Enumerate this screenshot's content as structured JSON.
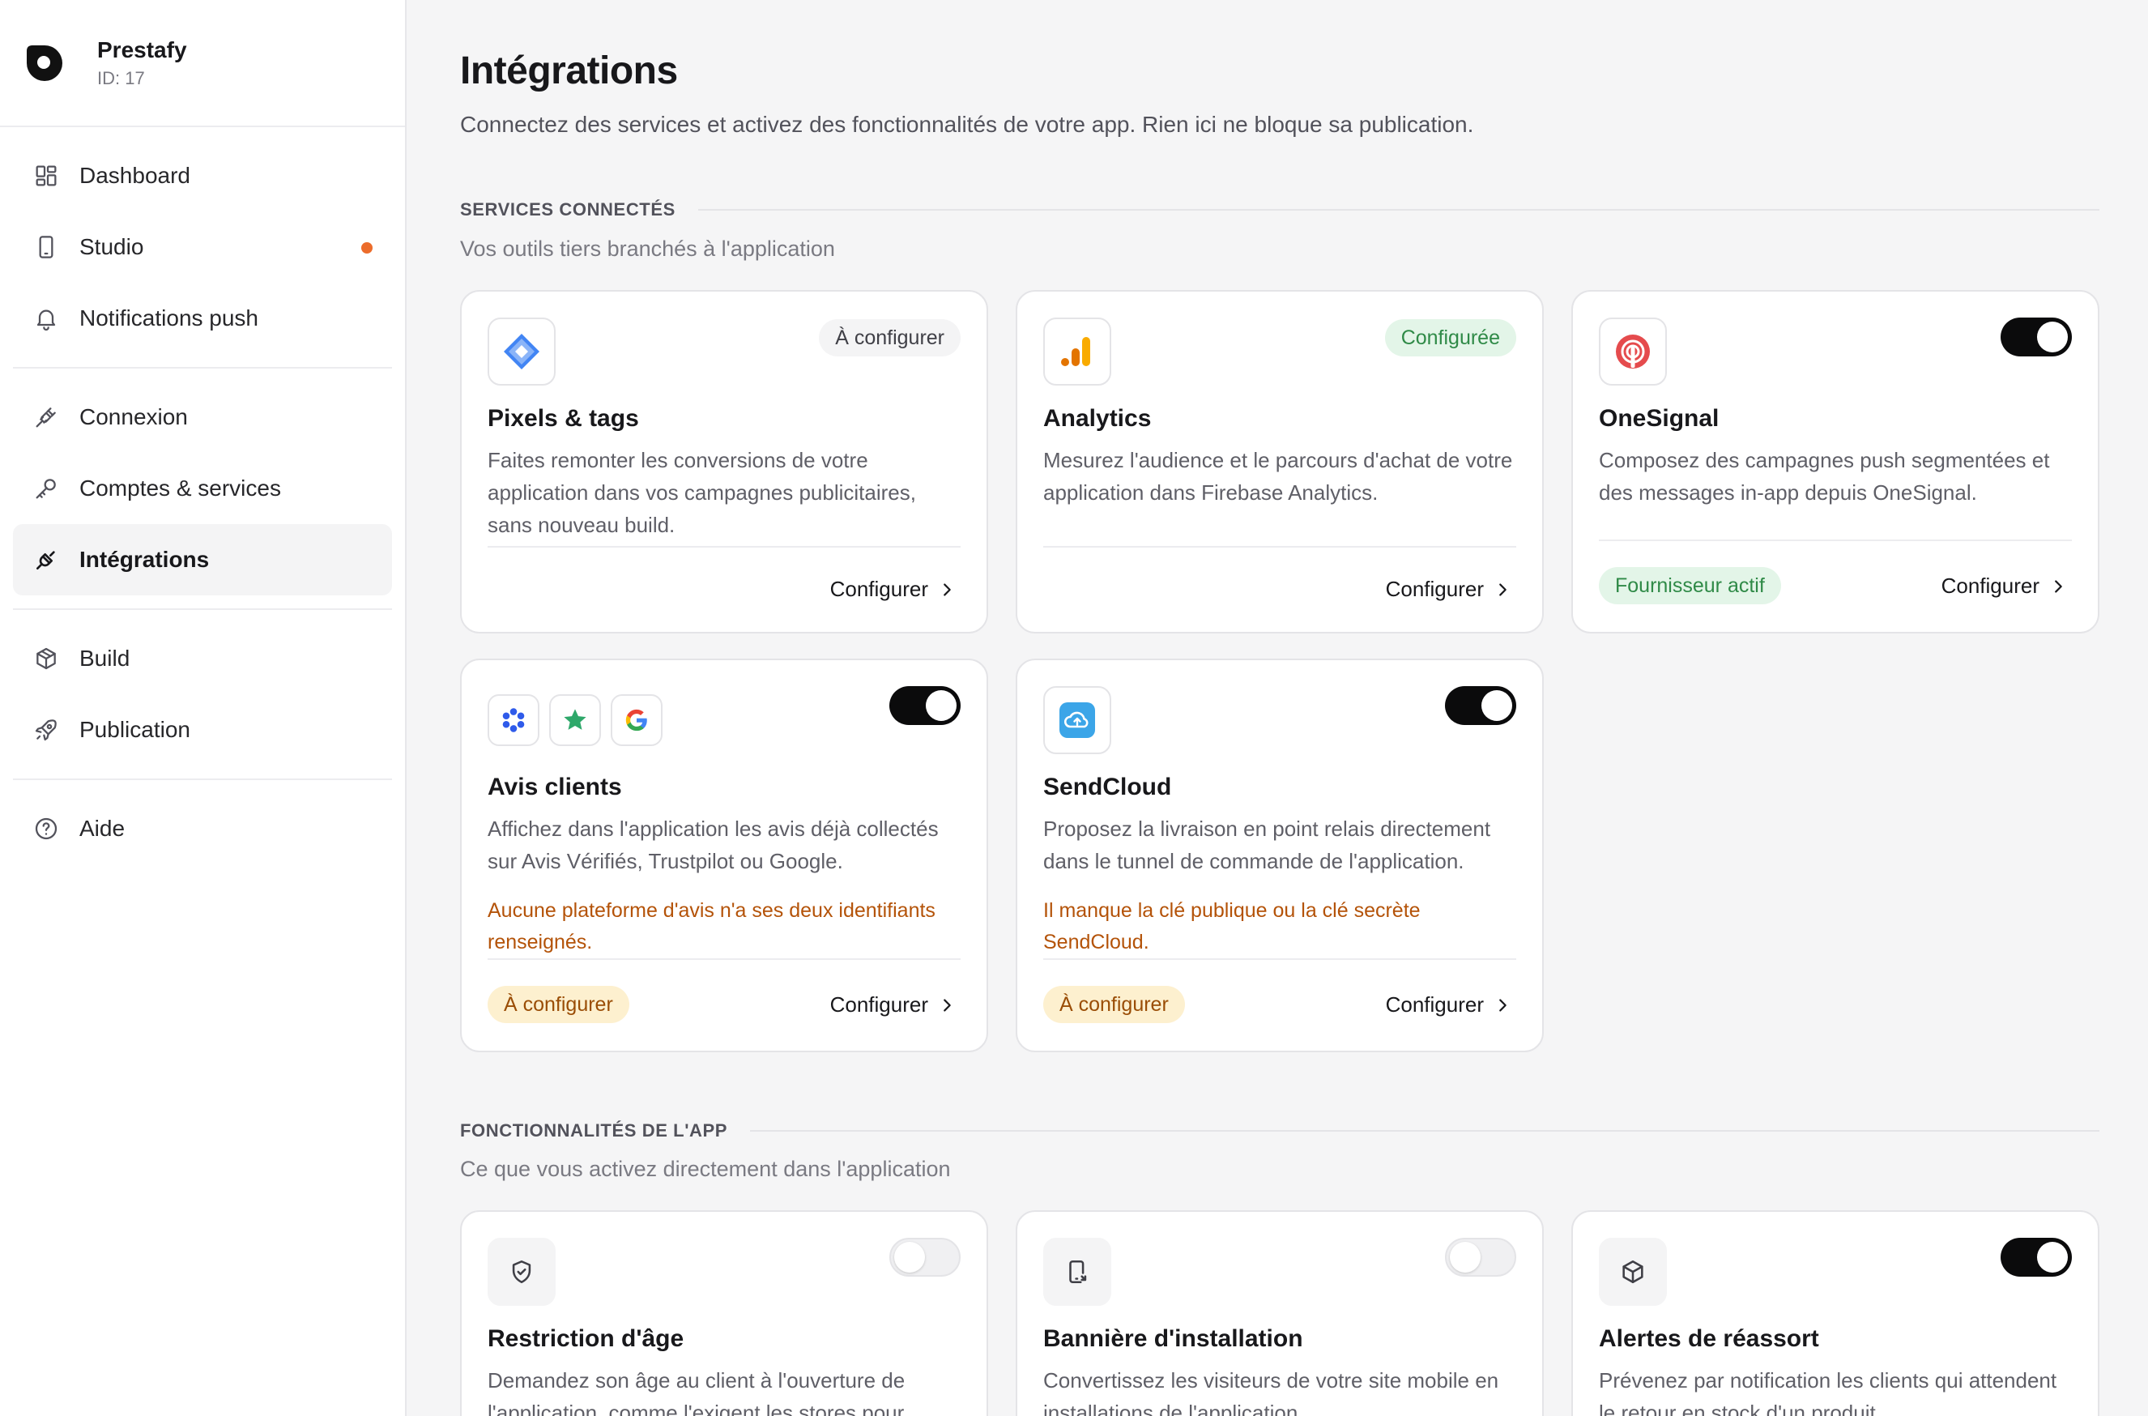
{
  "brand": {
    "name": "Prestafy",
    "id": "ID: 17"
  },
  "nav": {
    "dashboard": "Dashboard",
    "studio": "Studio",
    "push": "Notifications push",
    "connexion": "Connexion",
    "accounts": "Comptes & services",
    "integrations": "Intégrations",
    "build": "Build",
    "publication": "Publication",
    "help": "Aide"
  },
  "page": {
    "title": "Intégrations",
    "subtitle": "Connectez des services et activez des fonctionnalités de votre app. Rien ici ne bloque sa publication."
  },
  "services": {
    "title": "SERVICES CONNECTÉS",
    "subtitle": "Vos outils tiers branchés à l'application",
    "pixels": {
      "title": "Pixels & tags",
      "desc": "Faites remonter les conversions de votre application dans vos campagnes publicitaires, sans nouveau build.",
      "badge": "À configurer",
      "action": "Configurer"
    },
    "analytics": {
      "title": "Analytics",
      "desc": "Mesurez l'audience et le parcours d'achat de votre application dans Firebase Analytics.",
      "badge": "Configurée",
      "action": "Configurer"
    },
    "onesignal": {
      "title": "OneSignal",
      "desc": "Composez des campagnes push segmentées et des messages in-app depuis OneSignal.",
      "badge": "Fournisseur actif",
      "action": "Configurer",
      "enabled": true
    },
    "reviews": {
      "title": "Avis clients",
      "desc": "Affichez dans l'application les avis déjà collectés sur Avis Vérifiés, Trustpilot ou Google.",
      "warning": "Aucune plateforme d'avis n'a ses deux identifiants renseignés.",
      "badge": "À configurer",
      "action": "Configurer",
      "enabled": true
    },
    "sendcloud": {
      "title": "SendCloud",
      "desc": "Proposez la livraison en point relais directement dans le tunnel de commande de l'application.",
      "warning": "Il manque la clé publique ou la clé secrète SendCloud.",
      "badge": "À configurer",
      "action": "Configurer",
      "enabled": true
    }
  },
  "features": {
    "title": "FONCTIONNALITÉS DE L'APP",
    "subtitle": "Ce que vous activez directement dans l'application",
    "age": {
      "title": "Restriction d'âge",
      "desc": "Demandez son âge au client à l'ouverture de l'application, comme l'exigent les stores pour",
      "enabled": false
    },
    "banner": {
      "title": "Bannière d'installation",
      "desc": "Convertissez les visiteurs de votre site mobile en installations de l'application.",
      "enabled": false
    },
    "restock": {
      "title": "Alertes de réassort",
      "desc": "Prévenez par notification les clients qui attendent le retour en stock d'un produit.",
      "enabled": true
    }
  },
  "colors": {
    "accent_dot": "#ec6c2b",
    "badge_green": "#2f8a47",
    "badge_amber": "#9a4d06",
    "warning_text": "#b45309"
  }
}
